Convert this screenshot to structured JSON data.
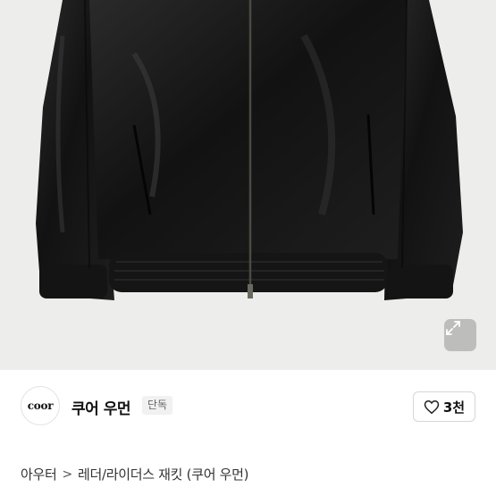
{
  "product_image": {
    "alt": "black leather bomber jacket",
    "expand_icon": "expand-arrows-icon"
  },
  "shop": {
    "logo_text": "coor",
    "name": "쿠어 우먼",
    "badge": "단독"
  },
  "like": {
    "icon": "heart-outline-icon",
    "count": "3천"
  },
  "breadcrumb": {
    "category": "아우터",
    "separator": ">",
    "subcategory": "레더/라이더스 재킷 (쿠어 우먼)"
  },
  "colors": {
    "background_image": "#ededeb",
    "jacket": "#151515",
    "text": "#111111"
  }
}
